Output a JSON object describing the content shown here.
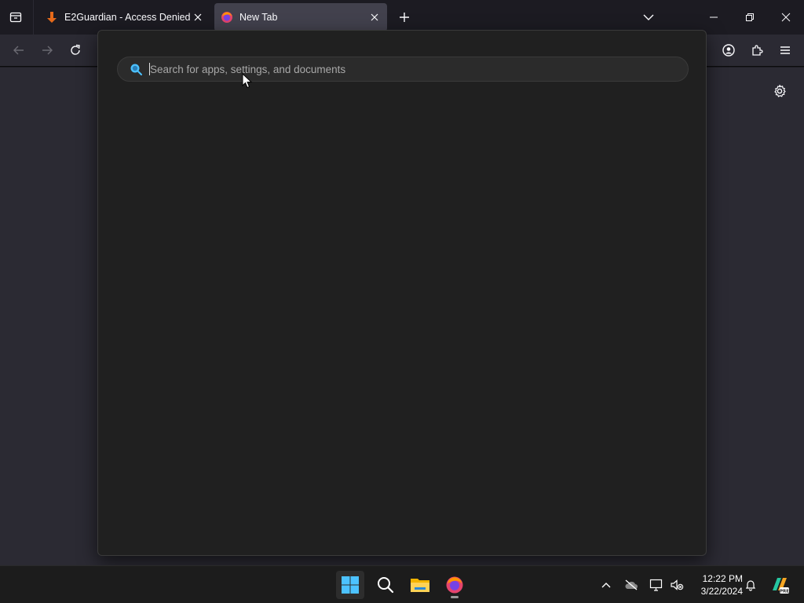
{
  "browser": {
    "tabs": [
      {
        "title": "E2Guardian - Access Denied",
        "favicon": "e2guardian-arrow-icon",
        "active": false
      },
      {
        "title": "New Tab",
        "favicon": "firefox-icon",
        "active": true
      }
    ],
    "toolbar": {
      "back": "back-arrow-icon",
      "forward": "forward-arrow-icon",
      "reload": "reload-icon",
      "account": "account-icon",
      "extensions": "extensions-icon",
      "menu": "hamburger-menu-icon"
    }
  },
  "windows_search": {
    "placeholder": "Search for apps, settings, and documents",
    "value": ""
  },
  "taskbar": {
    "pinned": [
      "windows-start-icon",
      "search-icon",
      "file-explorer-icon",
      "firefox-icon"
    ],
    "clock": {
      "time": "12:22 PM",
      "date": "3/22/2024"
    },
    "tray": [
      "chevron-up-icon",
      "onedrive-offline-icon",
      "network-icon",
      "volume-muted-icon",
      "notification-bell-icon",
      "copilot-pre-icon"
    ]
  },
  "colors": {
    "chrome_bg": "#1c1b22",
    "active_tab": "#42414d",
    "page_bg": "#2b2a33",
    "search_panel": "#202020",
    "accent_blue": "#4cc2ff",
    "e2guardian_orange": "#e66a1a"
  }
}
